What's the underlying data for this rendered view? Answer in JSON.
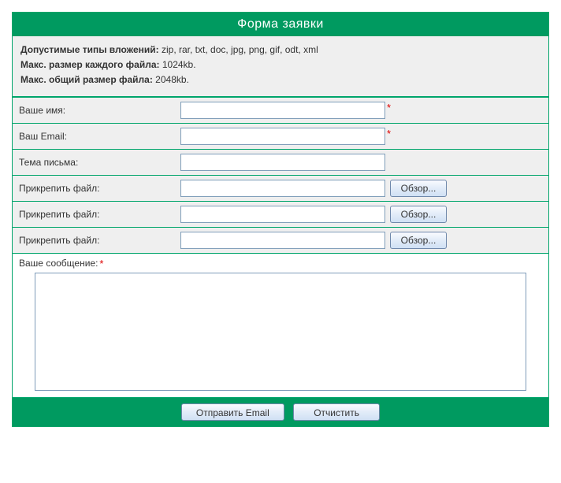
{
  "title": "Форма заявки",
  "info": {
    "allowed_label": "Допустимые типы вложений:",
    "allowed_types": " zip, rar, txt, doc, jpg, png, gif, odt, xml",
    "max_each_label": "Макс. размер каждого файла:",
    "max_each_value": " 1024kb.",
    "max_total_label": "Макс. общий размер файла:",
    "max_total_value": " 2048kb."
  },
  "fields": {
    "name_label": "Ваше имя:",
    "email_label": "Ваш Email:",
    "subject_label": "Тема письма:",
    "attach_label": "Прикрепить файл:",
    "browse_label": "Обзор...",
    "message_label": "Ваше сообщение:",
    "required_mark": "*"
  },
  "buttons": {
    "send": "Отправить Email",
    "clear": "Отчистить"
  }
}
